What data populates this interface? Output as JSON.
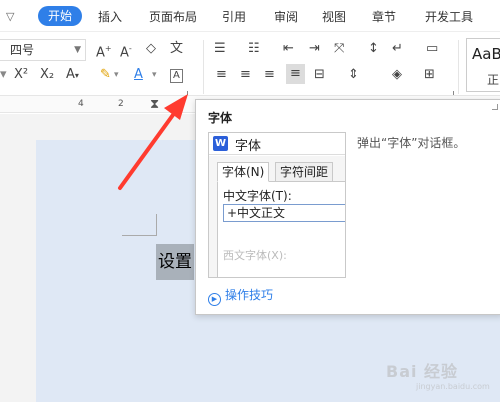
{
  "menubar": {
    "tabs": [
      {
        "label": "开始",
        "active": true
      },
      {
        "label": "插入"
      },
      {
        "label": "页面布局"
      },
      {
        "label": "引用"
      },
      {
        "label": "审阅"
      },
      {
        "label": "视图"
      },
      {
        "label": "章节"
      },
      {
        "label": "开发工具"
      }
    ]
  },
  "toolbar": {
    "font_size": "四号",
    "style_preview": "AaB",
    "style_name": "正"
  },
  "ruler": {
    "ticks": [
      "4",
      "2"
    ]
  },
  "document": {
    "selected_text": "设置"
  },
  "tooltip": {
    "title": "字体",
    "description": "弹出“字体”对话框。",
    "tips_label": "操作技巧",
    "dialog": {
      "title": "字体",
      "tabs": [
        "字体(N)",
        "字符间距"
      ],
      "chinese_font_label": "中文字体(T):",
      "chinese_font_value": "+中文正文",
      "western_font_label": "西文字体(X):"
    }
  },
  "watermark": "Bai 经验",
  "colors": {
    "accent": "#2f7fe8",
    "arrow": "#ff3b2f",
    "page_bg": "#dfe8f5",
    "selection": "#a9b1ba"
  }
}
